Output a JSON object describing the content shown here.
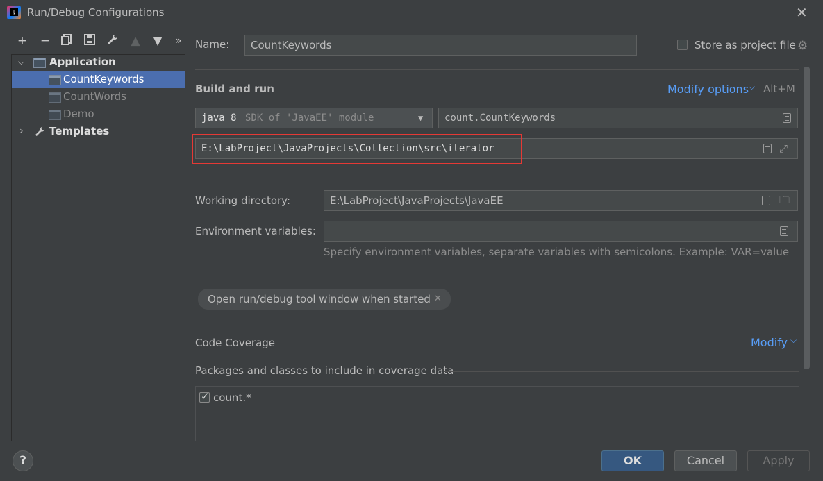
{
  "window": {
    "title": "Run/Debug Configurations"
  },
  "toolbar": {
    "buttons": [
      "+",
      "−",
      "⧉",
      "▤",
      "🔧",
      "▲",
      "▼",
      "»"
    ]
  },
  "tree": {
    "application": "Application",
    "items": [
      "CountKeywords",
      "CountWords",
      "Demo"
    ],
    "templates": "Templates"
  },
  "form": {
    "name_label": "Name:",
    "name_value": "CountKeywords",
    "store_label": "Store as project file",
    "build_run_label": "Build and run",
    "modify_options": "Modify options",
    "modify_shortcut": "Alt+M",
    "sdk_main": "java 8",
    "sdk_rest": "SDK of 'JavaEE' module",
    "main_class": "count.CountKeywords",
    "program_path": "E:\\LabProject\\JavaProjects\\Collection\\src\\iterator",
    "working_dir_label": "Working directory:",
    "working_dir_value": "E:\\LabProject\\JavaProjects\\JavaEE",
    "env_label": "Environment variables:",
    "env_hint": "Specify environment variables, separate variables with semicolons. Example: VAR=value",
    "chip_label": "Open run/debug tool window when started",
    "coverage_label": "Code Coverage",
    "coverage_modify": "Modify",
    "packages_label": "Packages and classes to include in coverage data",
    "package_item": "count.*"
  },
  "buttons": {
    "help": "?",
    "ok": "OK",
    "cancel": "Cancel",
    "apply": "Apply"
  },
  "colors": {
    "highlight": "#e53935",
    "accent": "#589df6",
    "selection": "#4b6eaf"
  }
}
